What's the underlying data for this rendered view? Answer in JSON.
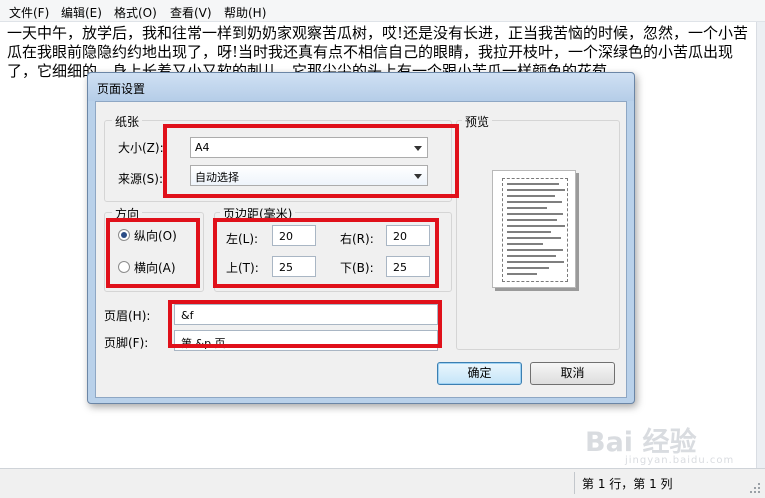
{
  "menu": {
    "items": [
      "文件(F)",
      "编辑(E)",
      "格式(O)",
      "查看(V)",
      "帮助(H)"
    ]
  },
  "editor": {
    "text": "一天中午，放学后，我和往常一样到奶奶家观察苦瓜树，哎!还是没有长进，正当我苦恼的时候，忽然，一个小苦瓜在我眼前隐隐约约地出现了，呀!当时我还真有点不相信自己的眼睛，我拉开枝叶，一个深绿色的小苦瓜出现了，它细细的，身上长着又小又软的刺儿，它那尖尖的头上有一个跟小苦瓜一样颜色的花苞，"
  },
  "status": {
    "position": "第 1 行，第 1 列"
  },
  "watermark": {
    "text": "Bai 经验",
    "subtext": "jingyan.baidu.com"
  },
  "dialog": {
    "title": "页面设置",
    "paper": {
      "legend": "纸张",
      "size_label": "大小(Z):",
      "size_value": "A4",
      "source_label": "来源(S):",
      "source_value": "自动选择"
    },
    "orientation": {
      "legend": "方向",
      "portrait_label": "纵向(O)",
      "landscape_label": "横向(A)",
      "selected": "portrait"
    },
    "margins": {
      "legend": "页边距(毫米)",
      "left_label": "左(L):",
      "left_value": "20",
      "right_label": "右(R):",
      "right_value": "20",
      "top_label": "上(T):",
      "top_value": "25",
      "bottom_label": "下(B):",
      "bottom_value": "25"
    },
    "preview": {
      "legend": "预览"
    },
    "header": {
      "label": "页眉(H):",
      "value": "&f"
    },
    "footer": {
      "label": "页脚(F):",
      "value": "第 &p 页"
    },
    "buttons": {
      "ok": "确定",
      "cancel": "取消"
    }
  },
  "colors": {
    "highlight": "#e0101a",
    "dialog_frame": "#b9d1ea",
    "client_bg": "#f0f0f0"
  }
}
